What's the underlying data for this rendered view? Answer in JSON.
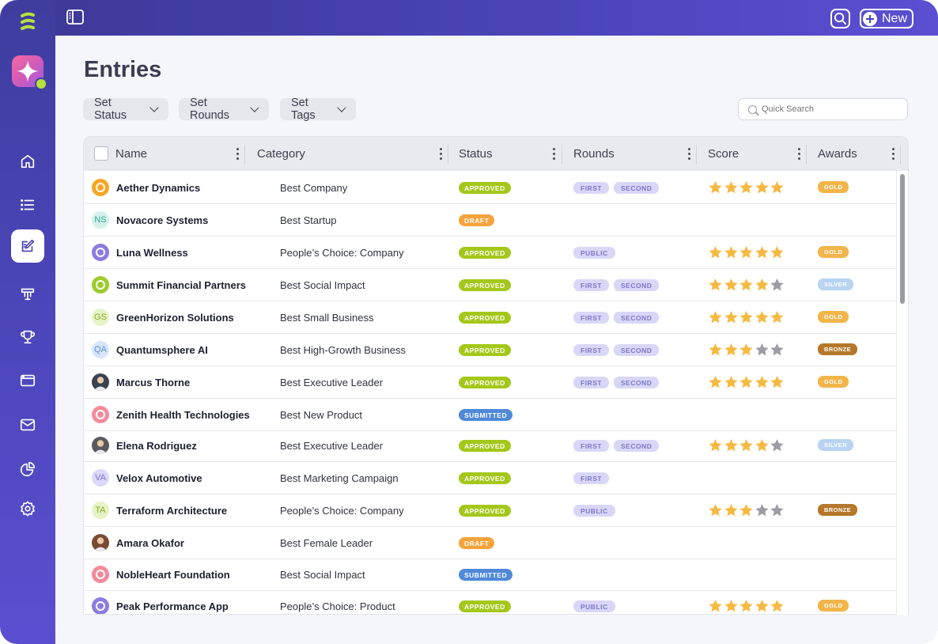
{
  "header": {
    "new_label": "New"
  },
  "page": {
    "title": "Entries"
  },
  "filters": [
    {
      "label": "Set Status"
    },
    {
      "label": "Set Rounds"
    },
    {
      "label": "Set Tags"
    }
  ],
  "search": {
    "placeholder": "Quick Search"
  },
  "columns": [
    "Name",
    "Category",
    "Status",
    "Rounds",
    "Score",
    "Awards"
  ],
  "colors": {
    "approved": "#a3c81a",
    "draft": "#f5a33b",
    "submitted": "#4f89d9",
    "gold": "#f2b54a",
    "silver": "#b8d4f2",
    "bronze": "#b5782a",
    "star_filled": "#f5b942",
    "star_empty": "#9c9ca4"
  },
  "rows": [
    {
      "name": "Aether Dynamics",
      "category": "Best Company",
      "status": "APPROVED",
      "rounds": [
        "FIRST",
        "SECOND"
      ],
      "score": 5,
      "award": "GOLD",
      "avatar": {
        "type": "logo",
        "bg": "#f5a623",
        "color": "#ffffff",
        "text": ""
      }
    },
    {
      "name": "Novacore Systems",
      "category": "Best Startup",
      "status": "DRAFT",
      "rounds": [],
      "score": null,
      "award": "",
      "avatar": {
        "type": "initials",
        "bg": "#d3f2ec",
        "color": "#3aa795",
        "text": "NS"
      }
    },
    {
      "name": "Luna Wellness",
      "category": "People’s Choice: Company",
      "status": "APPROVED",
      "rounds": [
        "PUBLIC"
      ],
      "score": 5,
      "award": "GOLD",
      "avatar": {
        "type": "logo",
        "bg": "#8e7be0",
        "color": "#ffffff",
        "text": ""
      }
    },
    {
      "name": "Summit Financial Partners",
      "category": "Best Social Impact",
      "status": "APPROVED",
      "rounds": [
        "FIRST",
        "SECOND"
      ],
      "score": 4,
      "award": "SILVER",
      "avatar": {
        "type": "logo",
        "bg": "#9ccc2a",
        "color": "#ffffff",
        "text": ""
      }
    },
    {
      "name": "GreenHorizon Solutions",
      "category": "Best Small Business",
      "status": "APPROVED",
      "rounds": [
        "FIRST",
        "SECOND"
      ],
      "score": 5,
      "award": "GOLD",
      "avatar": {
        "type": "initials",
        "bg": "#e6f3c6",
        "color": "#88ad2a",
        "text": "GS"
      }
    },
    {
      "name": "Quantumsphere AI",
      "category": "Best High-Growth Business",
      "status": "APPROVED",
      "rounds": [
        "FIRST",
        "SECOND"
      ],
      "score": 3,
      "award": "BRONZE",
      "avatar": {
        "type": "initials",
        "bg": "#d7e6fa",
        "color": "#5a8fd6",
        "text": "QA"
      }
    },
    {
      "name": "Marcus Thorne",
      "category": "Best Executive Leader",
      "status": "APPROVED",
      "rounds": [
        "FIRST",
        "SECOND"
      ],
      "score": 5,
      "award": "GOLD",
      "avatar": {
        "type": "photo",
        "bg": "#3b4250",
        "color": "#ffffff",
        "text": ""
      }
    },
    {
      "name": "Zenith Health Technologies",
      "category": "Best New Product",
      "status": "SUBMITTED",
      "rounds": [],
      "score": null,
      "award": "",
      "avatar": {
        "type": "logo",
        "bg": "#f48a9a",
        "color": "#ffffff",
        "text": ""
      }
    },
    {
      "name": "Elena Rodriguez",
      "category": "Best Executive Leader",
      "status": "APPROVED",
      "rounds": [
        "FIRST",
        "SECOND"
      ],
      "score": 4,
      "award": "SILVER",
      "avatar": {
        "type": "photo",
        "bg": "#5a5a5e",
        "color": "#ffffff",
        "text": ""
      }
    },
    {
      "name": "Velox Automotive",
      "category": "Best Marketing Campaign",
      "status": "APPROVED",
      "rounds": [
        "FIRST"
      ],
      "score": null,
      "award": "",
      "avatar": {
        "type": "initials",
        "bg": "#dcd8f8",
        "color": "#7d73d6",
        "text": "VA"
      }
    },
    {
      "name": "Terraform Architecture",
      "category": "People’s Choice: Company",
      "status": "APPROVED",
      "rounds": [
        "PUBLIC"
      ],
      "score": 3,
      "award": "BRONZE",
      "avatar": {
        "type": "initials",
        "bg": "#e6f3c6",
        "color": "#88ad2a",
        "text": "TA"
      }
    },
    {
      "name": "Amara Okafor",
      "category": "Best Female Leader",
      "status": "DRAFT",
      "rounds": [],
      "score": null,
      "award": "",
      "avatar": {
        "type": "photo",
        "bg": "#7a4a32",
        "color": "#ffffff",
        "text": ""
      }
    },
    {
      "name": "NobleHeart Foundation",
      "category": "Best Social Impact",
      "status": "SUBMITTED",
      "rounds": [],
      "score": null,
      "award": "",
      "avatar": {
        "type": "logo",
        "bg": "#f48a9a",
        "color": "#ffffff",
        "text": ""
      }
    },
    {
      "name": "Peak Performance App",
      "category": "People’s Choice: Product",
      "status": "APPROVED",
      "rounds": [
        "PUBLIC"
      ],
      "score": 5,
      "award": "GOLD",
      "avatar": {
        "type": "logo",
        "bg": "#8e7be0",
        "color": "#ffffff",
        "text": ""
      }
    }
  ]
}
